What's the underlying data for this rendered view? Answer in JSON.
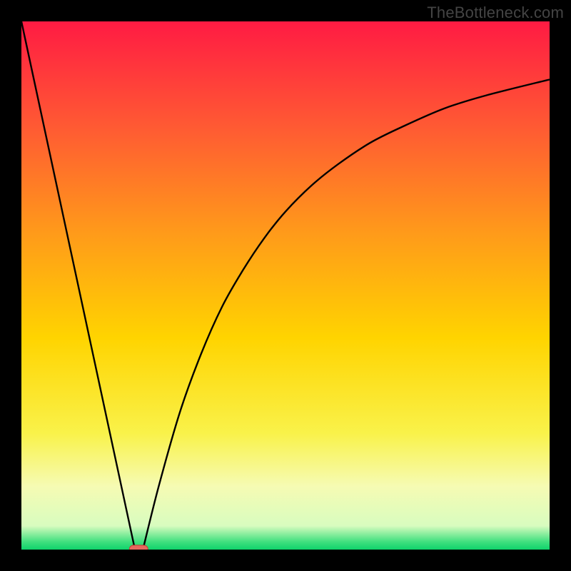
{
  "watermark": "TheBottleneck.com",
  "colors": {
    "frame": "#000000",
    "curve": "#000000",
    "marker_fill": "#e6675e",
    "marker_stroke": "#cc3a33",
    "gradient_stops": [
      {
        "offset": 0.0,
        "color": "#ff1b43"
      },
      {
        "offset": 0.2,
        "color": "#ff5a33"
      },
      {
        "offset": 0.4,
        "color": "#ff9a1a"
      },
      {
        "offset": 0.6,
        "color": "#ffd400"
      },
      {
        "offset": 0.78,
        "color": "#f9f24a"
      },
      {
        "offset": 0.88,
        "color": "#f6fbb3"
      },
      {
        "offset": 0.955,
        "color": "#d8fcbf"
      },
      {
        "offset": 0.985,
        "color": "#41e07f"
      },
      {
        "offset": 1.0,
        "color": "#0fd36b"
      }
    ]
  },
  "chart_data": {
    "type": "line",
    "title": "",
    "xlabel": "",
    "ylabel": "",
    "xlim": [
      0,
      100
    ],
    "ylim": [
      0,
      100
    ],
    "legend": null,
    "annotations": [],
    "series": [
      {
        "name": "left-linear-branch",
        "x": [
          0,
          21.5
        ],
        "y": [
          100,
          0
        ],
        "style": "line"
      },
      {
        "name": "right-curve-branch",
        "x": [
          23,
          26,
          30,
          34,
          38,
          42,
          46,
          50,
          55,
          60,
          66,
          72,
          80,
          88,
          100
        ],
        "y": [
          0,
          12,
          26,
          37,
          46,
          53,
          59,
          64,
          69,
          73,
          77,
          80,
          83.5,
          86,
          89
        ],
        "style": "curve"
      }
    ],
    "marker": {
      "name": "bottleneck-marker",
      "x": 22.2,
      "y": 0,
      "width": 3.5,
      "height": 1.4,
      "shape": "rounded-rect"
    }
  }
}
